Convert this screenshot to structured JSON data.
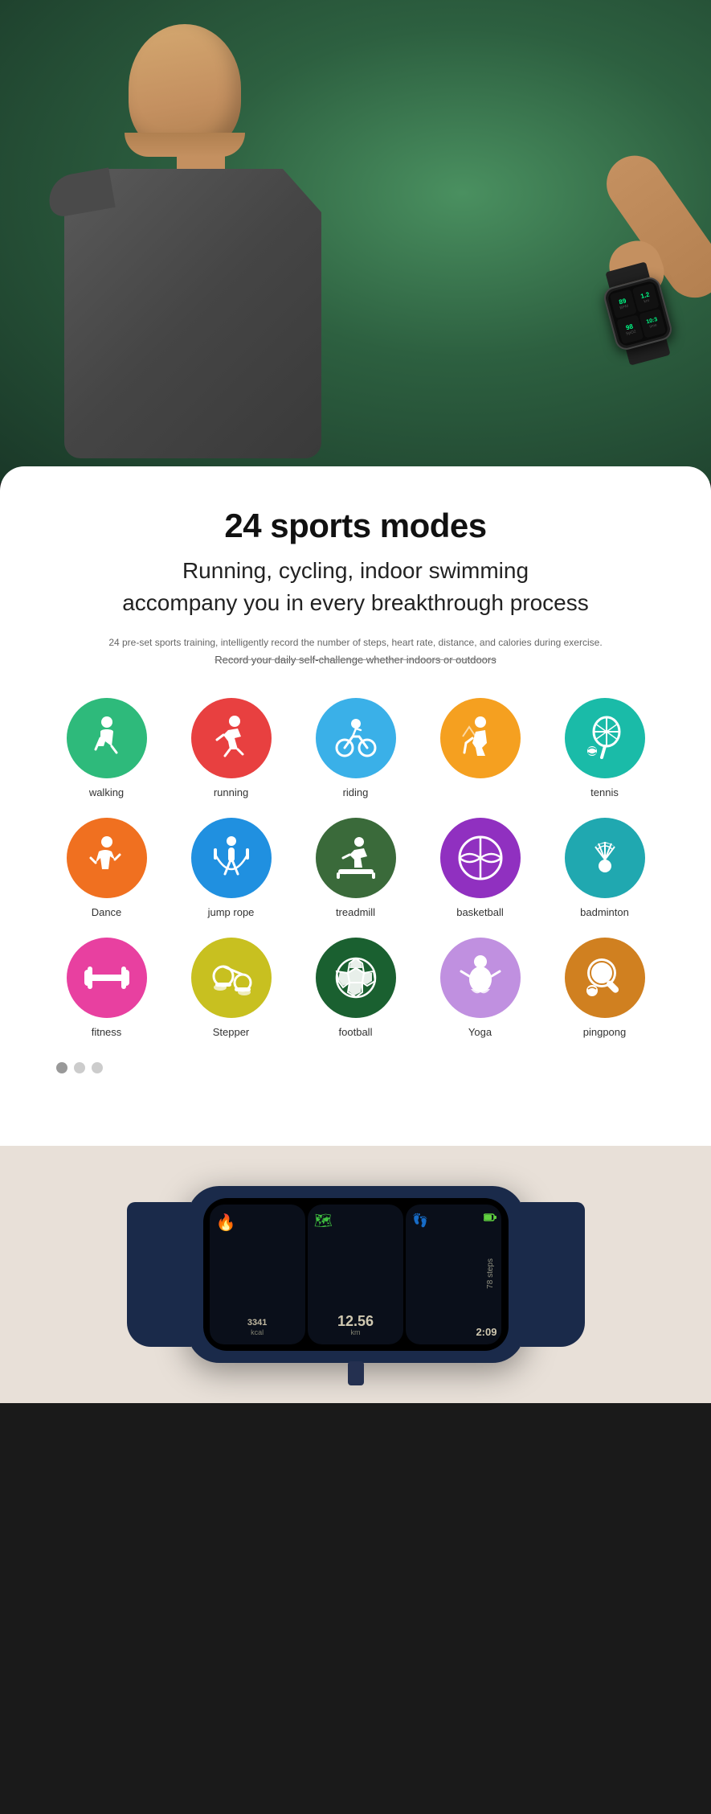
{
  "hero": {
    "background_color": "#2d5a3d",
    "alt_text": "Person wearing smartwatch"
  },
  "sports_section": {
    "title": "24 sports modes",
    "subtitle_line1": "Running, cycling, indoor swimming",
    "subtitle_line2": "accompany you in every breakthrough process",
    "description1": "24 pre-set sports training, intelligently record the number of steps, heart rate, distance, and calories during exercise.",
    "description2": "Record your daily self-challenge whether indoors or outdoors"
  },
  "sports": [
    {
      "id": "walking",
      "label": "walking",
      "color": "#2eba7b",
      "icon_type": "walking"
    },
    {
      "id": "running",
      "label": "running",
      "color": "#e84040",
      "icon_type": "running"
    },
    {
      "id": "riding",
      "label": "riding",
      "color": "#3ab0e8",
      "icon_type": "riding"
    },
    {
      "id": "hiking",
      "label": "",
      "color": "#f5a020",
      "icon_type": "hiking"
    },
    {
      "id": "tennis",
      "label": "tennis",
      "color": "#1abba8",
      "icon_type": "tennis"
    },
    {
      "id": "dance",
      "label": "Dance",
      "color": "#f07020",
      "icon_type": "dance"
    },
    {
      "id": "jumprope",
      "label": "jump rope",
      "color": "#2090e0",
      "icon_type": "jumprope"
    },
    {
      "id": "treadmill",
      "label": "treadmill",
      "color": "#3a6a3a",
      "icon_type": "treadmill"
    },
    {
      "id": "basketball",
      "label": "basketball",
      "color": "#9030c0",
      "icon_type": "basketball"
    },
    {
      "id": "badminton",
      "label": "badminton",
      "color": "#20a8b0",
      "icon_type": "badminton"
    },
    {
      "id": "fitness",
      "label": "fitness",
      "color": "#e840a0",
      "icon_type": "fitness"
    },
    {
      "id": "stepper",
      "label": "Stepper",
      "color": "#c8c020",
      "icon_type": "stepper"
    },
    {
      "id": "football",
      "label": "football",
      "color": "#1a6030",
      "icon_type": "football"
    },
    {
      "id": "yoga",
      "label": "Yoga",
      "color": "#c090e0",
      "icon_type": "yoga"
    },
    {
      "id": "pingpong",
      "label": "pingpong",
      "color": "#d08020",
      "icon_type": "pingpong"
    }
  ],
  "pagination": {
    "dots": [
      "active",
      "inactive",
      "inactive"
    ]
  },
  "watch_display": {
    "panel1": {
      "icon": "🔥",
      "value": "3341",
      "unit": "kcal"
    },
    "panel2": {
      "icon": "🗺",
      "value": "12.56",
      "unit": "km"
    },
    "panel3": {
      "icon": "👣",
      "value": "78",
      "unit": "steps",
      "time": "2:09"
    }
  }
}
